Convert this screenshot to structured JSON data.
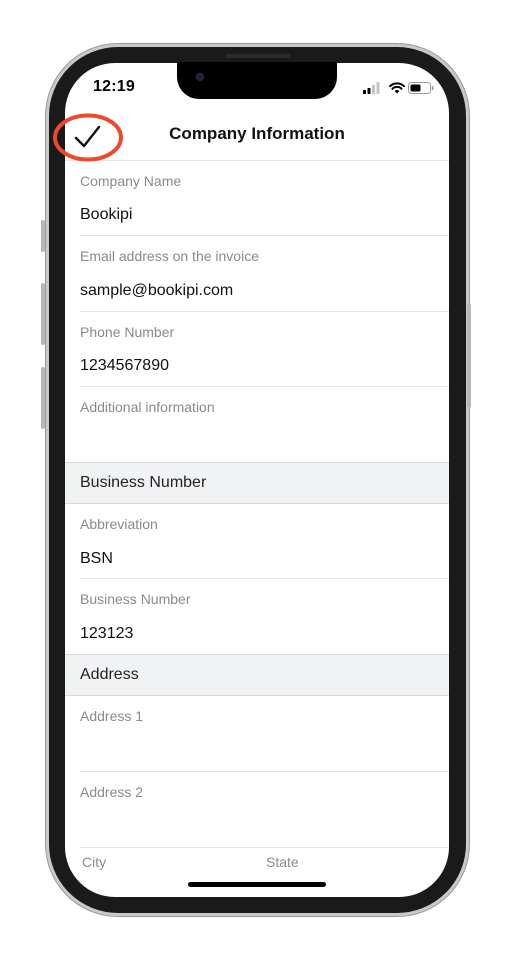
{
  "status_bar": {
    "time": "12:19",
    "icons": [
      "cellular-signal-icon",
      "wifi-icon",
      "battery-icon"
    ]
  },
  "nav": {
    "title": "Company Information",
    "done_icon": "checkmark-icon",
    "highlight_color": "#ee4a2a"
  },
  "company": {
    "name_label": "Company Name",
    "name_value": "Bookipi",
    "email_label": "Email address on the invoice",
    "email_value": "sample@bookipi.com",
    "phone_label": "Phone Number",
    "phone_value": "1234567890",
    "additional_label": "Additional information",
    "additional_value": ""
  },
  "business": {
    "section_title": "Business Number",
    "abbreviation_label": "Abbreviation",
    "abbreviation_value": "BSN",
    "number_label": "Business Number",
    "number_value": "123123"
  },
  "address": {
    "section_title": "Address",
    "address1_label": "Address 1",
    "address1_value": "",
    "address2_label": "Address 2",
    "address2_value": "",
    "city_label": "City",
    "state_label": "State"
  }
}
